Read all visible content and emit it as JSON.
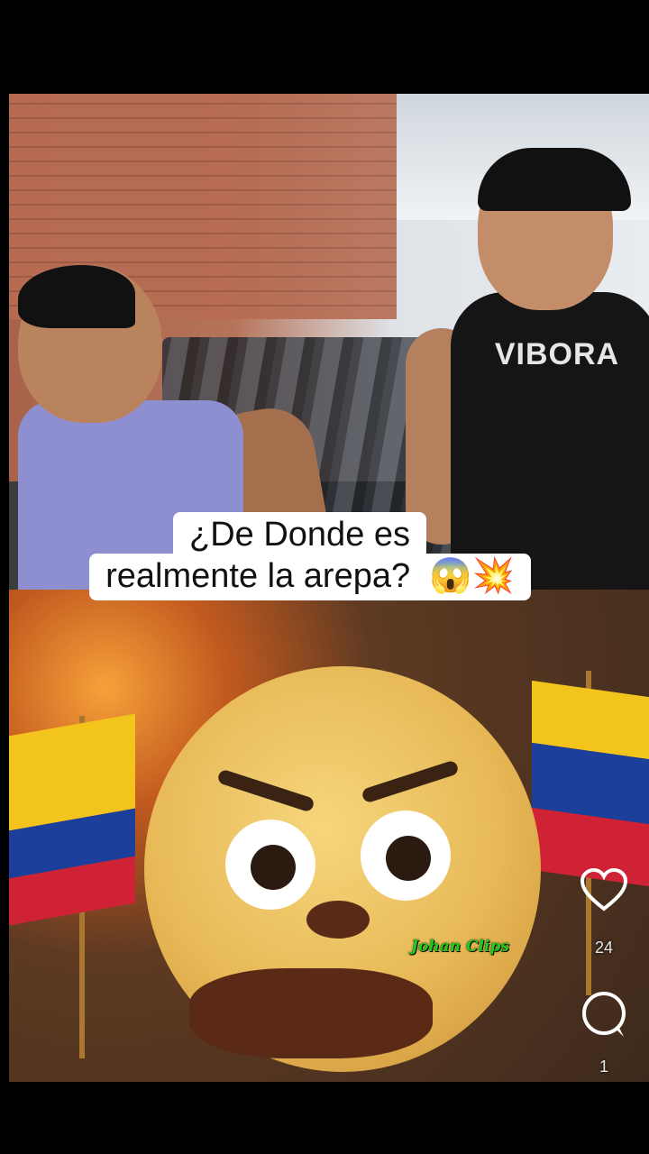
{
  "video": {
    "caption_line1": "¿De Donde es",
    "caption_line2": "realmente la arepa?",
    "caption_emoji": "😱💥",
    "shirt_logo": "VIBORA",
    "watermark": "Johan Clips"
  },
  "actions": {
    "like_count": "24",
    "comment_count": "1",
    "like_icon": "heart-outline-icon",
    "comment_icon": "comment-bubble-icon"
  },
  "colors": {
    "caption_bg": "#ffffff",
    "watermark": "#1ccf1c"
  }
}
